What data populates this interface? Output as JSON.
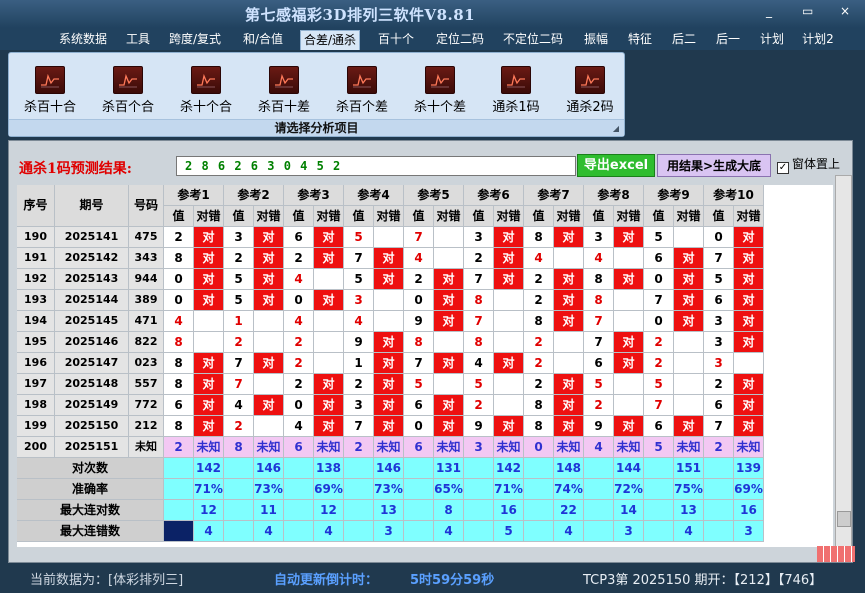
{
  "app": {
    "title": "第七感福彩3D排列三软件V8.81",
    "window_controls": [
      "_",
      "▭",
      "×"
    ]
  },
  "menu": [
    {
      "label": "系统数据",
      "active": false
    },
    {
      "label": "工具",
      "active": false
    },
    {
      "label": "跨度/复式",
      "active": false
    },
    {
      "label": "和/合值",
      "active": false
    },
    {
      "label": "合差/通杀",
      "active": true
    },
    {
      "label": "百十个",
      "active": false
    },
    {
      "label": "定位二码",
      "active": false
    },
    {
      "label": "不定位二码",
      "active": false
    },
    {
      "label": "振幅",
      "active": false
    },
    {
      "label": "特征",
      "active": false
    },
    {
      "label": "后二",
      "active": false
    },
    {
      "label": "后一",
      "active": false
    },
    {
      "label": "计划",
      "active": false
    },
    {
      "label": "计划2",
      "active": false
    }
  ],
  "ribbon": {
    "buttons": [
      "杀百十合",
      "杀百个合",
      "杀十个合",
      "杀百十差",
      "杀百个差",
      "杀十个差",
      "通杀1码",
      "通杀2码"
    ],
    "caption": "请选择分析项目",
    "icon": "chart-line-icon"
  },
  "prediction": {
    "label": "通杀1码预测结果:",
    "value": "2 8 6 2 6 3 0 4 5 2",
    "excel_button": "导出excel",
    "generate_button": "用结果>生成大底",
    "topmost_label": "窗体置上",
    "topmost_checked": true
  },
  "table": {
    "col_headers": {
      "seq": "序号",
      "period": "期号",
      "number": "号码",
      "value": "值",
      "result": "对错"
    },
    "ref_headers": [
      "参考1",
      "参考2",
      "参考3",
      "参考4",
      "参考5",
      "参考6",
      "参考7",
      "参考8",
      "参考9",
      "参考10"
    ],
    "rows": [
      {
        "seq": "190",
        "period": "2025141",
        "number": "475",
        "refs": [
          [
            "2",
            "对"
          ],
          [
            "3",
            "对"
          ],
          [
            "6",
            "对"
          ],
          [
            "5",
            ""
          ],
          [
            "7",
            ""
          ],
          [
            "3",
            "对"
          ],
          [
            "8",
            "对"
          ],
          [
            "3",
            "对"
          ],
          [
            "5",
            ""
          ],
          [
            "0",
            "对"
          ]
        ]
      },
      {
        "seq": "191",
        "period": "2025142",
        "number": "343",
        "refs": [
          [
            "8",
            "对"
          ],
          [
            "2",
            "对"
          ],
          [
            "2",
            "对"
          ],
          [
            "7",
            "对"
          ],
          [
            "4",
            ""
          ],
          [
            "2",
            "对"
          ],
          [
            "4",
            ""
          ],
          [
            "4",
            ""
          ],
          [
            "6",
            "对"
          ],
          [
            "7",
            "对"
          ]
        ]
      },
      {
        "seq": "192",
        "period": "2025143",
        "number": "944",
        "refs": [
          [
            "0",
            "对"
          ],
          [
            "5",
            "对"
          ],
          [
            "4",
            ""
          ],
          [
            "5",
            "对"
          ],
          [
            "2",
            "对"
          ],
          [
            "7",
            "对"
          ],
          [
            "2",
            "对"
          ],
          [
            "8",
            "对"
          ],
          [
            "0",
            "对"
          ],
          [
            "5",
            "对"
          ]
        ]
      },
      {
        "seq": "193",
        "period": "2025144",
        "number": "389",
        "refs": [
          [
            "0",
            "对"
          ],
          [
            "5",
            "对"
          ],
          [
            "0",
            "对"
          ],
          [
            "3",
            ""
          ],
          [
            "0",
            "对"
          ],
          [
            "8",
            ""
          ],
          [
            "2",
            "对"
          ],
          [
            "8",
            ""
          ],
          [
            "7",
            "对"
          ],
          [
            "6",
            "对"
          ]
        ]
      },
      {
        "seq": "194",
        "period": "2025145",
        "number": "471",
        "refs": [
          [
            "4",
            ""
          ],
          [
            "1",
            ""
          ],
          [
            "4",
            ""
          ],
          [
            "4",
            ""
          ],
          [
            "9",
            "对"
          ],
          [
            "7",
            ""
          ],
          [
            "8",
            "对"
          ],
          [
            "7",
            ""
          ],
          [
            "0",
            "对"
          ],
          [
            "3",
            "对"
          ]
        ]
      },
      {
        "seq": "195",
        "period": "2025146",
        "number": "822",
        "refs": [
          [
            "8",
            ""
          ],
          [
            "2",
            ""
          ],
          [
            "2",
            ""
          ],
          [
            "9",
            "对"
          ],
          [
            "8",
            ""
          ],
          [
            "8",
            ""
          ],
          [
            "2",
            ""
          ],
          [
            "7",
            "对"
          ],
          [
            "2",
            ""
          ],
          [
            "3",
            "对"
          ]
        ]
      },
      {
        "seq": "196",
        "period": "2025147",
        "number": "023",
        "refs": [
          [
            "8",
            "对"
          ],
          [
            "7",
            "对"
          ],
          [
            "2",
            ""
          ],
          [
            "1",
            "对"
          ],
          [
            "7",
            "对"
          ],
          [
            "4",
            "对"
          ],
          [
            "2",
            ""
          ],
          [
            "6",
            "对"
          ],
          [
            "2",
            ""
          ],
          [
            "3",
            ""
          ]
        ]
      },
      {
        "seq": "197",
        "period": "2025148",
        "number": "557",
        "refs": [
          [
            "8",
            "对"
          ],
          [
            "7",
            ""
          ],
          [
            "2",
            "对"
          ],
          [
            "2",
            "对"
          ],
          [
            "5",
            ""
          ],
          [
            "5",
            ""
          ],
          [
            "2",
            "对"
          ],
          [
            "5",
            ""
          ],
          [
            "5",
            ""
          ],
          [
            "2",
            "对"
          ]
        ]
      },
      {
        "seq": "198",
        "period": "2025149",
        "number": "772",
        "refs": [
          [
            "6",
            "对"
          ],
          [
            "4",
            "对"
          ],
          [
            "0",
            "对"
          ],
          [
            "3",
            "对"
          ],
          [
            "6",
            "对"
          ],
          [
            "2",
            ""
          ],
          [
            "8",
            "对"
          ],
          [
            "2",
            ""
          ],
          [
            "7",
            ""
          ],
          [
            "6",
            "对"
          ]
        ]
      },
      {
        "seq": "199",
        "period": "2025150",
        "number": "212",
        "refs": [
          [
            "8",
            "对"
          ],
          [
            "2",
            ""
          ],
          [
            "4",
            "对"
          ],
          [
            "7",
            "对"
          ],
          [
            "0",
            "对"
          ],
          [
            "9",
            "对"
          ],
          [
            "8",
            "对"
          ],
          [
            "9",
            "对"
          ],
          [
            "6",
            "对"
          ],
          [
            "7",
            "对"
          ]
        ]
      },
      {
        "seq": "200",
        "period": "2025151",
        "number": "未知",
        "refs": [
          [
            "2",
            "未知"
          ],
          [
            "8",
            "未知"
          ],
          [
            "6",
            "未知"
          ],
          [
            "2",
            "未知"
          ],
          [
            "6",
            "未知"
          ],
          [
            "3",
            "未知"
          ],
          [
            "0",
            "未知"
          ],
          [
            "4",
            "未知"
          ],
          [
            "5",
            "未知"
          ],
          [
            "2",
            "未知"
          ]
        ]
      }
    ],
    "red_value_cells": [
      [
        0,
        3
      ],
      [
        0,
        4
      ],
      [
        1,
        4
      ],
      [
        1,
        6
      ],
      [
        1,
        7
      ],
      [
        2,
        2
      ],
      [
        3,
        3
      ],
      [
        3,
        5
      ],
      [
        3,
        7
      ],
      [
        4,
        0
      ],
      [
        4,
        1
      ],
      [
        4,
        2
      ],
      [
        4,
        3
      ],
      [
        4,
        5
      ],
      [
        4,
        7
      ],
      [
        5,
        0
      ],
      [
        5,
        1
      ],
      [
        5,
        2
      ],
      [
        5,
        4
      ],
      [
        5,
        5
      ],
      [
        5,
        6
      ],
      [
        5,
        8
      ],
      [
        6,
        2
      ],
      [
        6,
        6
      ],
      [
        6,
        8
      ],
      [
        6,
        9
      ],
      [
        7,
        1
      ],
      [
        7,
        4
      ],
      [
        7,
        5
      ],
      [
        7,
        7
      ],
      [
        7,
        8
      ],
      [
        8,
        5
      ],
      [
        8,
        7
      ],
      [
        8,
        8
      ],
      [
        9,
        1
      ]
    ],
    "stats": [
      {
        "label": "对次数",
        "values": [
          "142",
          "146",
          "138",
          "146",
          "131",
          "142",
          "148",
          "144",
          "151",
          "139"
        ]
      },
      {
        "label": "准确率",
        "values": [
          "71%",
          "73%",
          "69%",
          "73%",
          "65%",
          "71%",
          "74%",
          "72%",
          "75%",
          "69%"
        ]
      },
      {
        "label": "最大连对数",
        "values": [
          "12",
          "11",
          "12",
          "13",
          "8",
          "16",
          "22",
          "14",
          "13",
          "16"
        ]
      },
      {
        "label": "最大连错数",
        "values": [
          "4",
          "4",
          "4",
          "3",
          "4",
          "5",
          "4",
          "3",
          "4",
          "3"
        ]
      }
    ]
  },
  "status": {
    "current_data": "当前数据为：[体彩排列三]",
    "countdown_label": "自动更新倒计时：",
    "countdown_value": "5时59分59秒",
    "draw_info": "TCP3第 2025150 期开：【212】【746】"
  },
  "colors": {
    "hit": "#ee1010",
    "unknown": "#f3c8f3",
    "stats": "#7fffff",
    "prediction_label": "#e00000"
  }
}
